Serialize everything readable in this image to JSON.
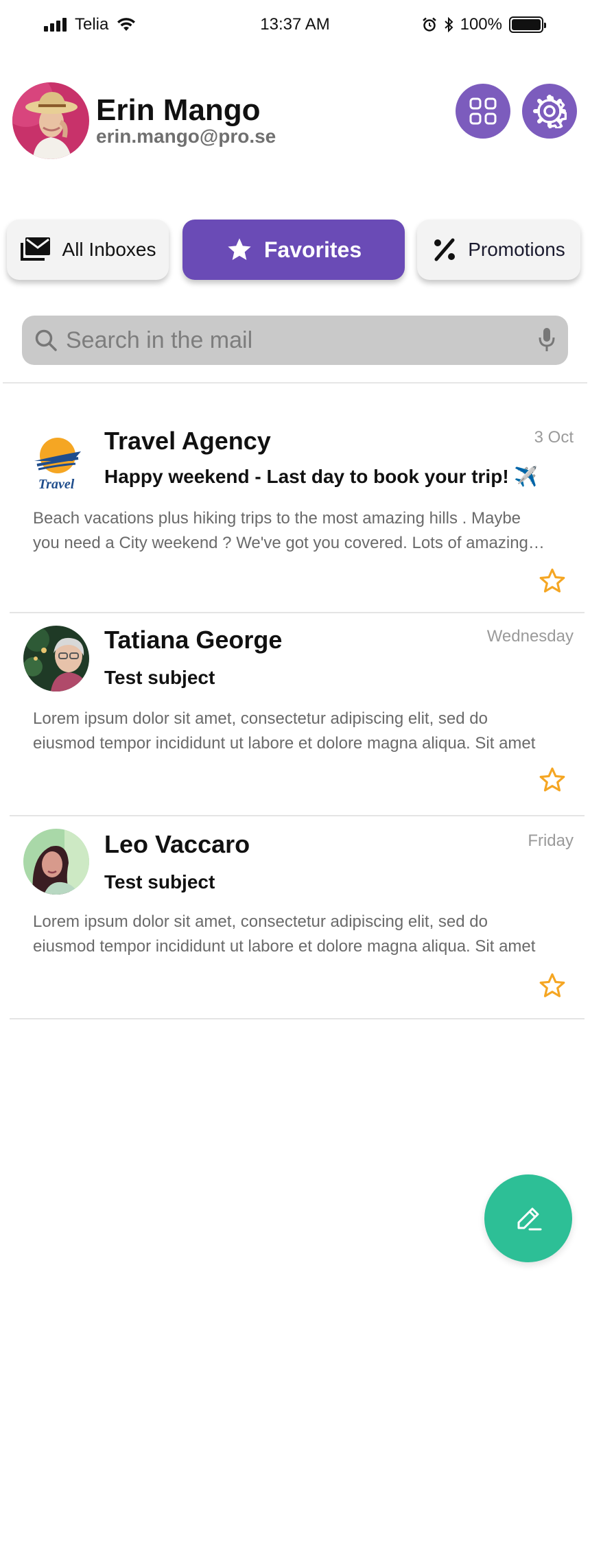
{
  "status_bar": {
    "carrier": "Telia",
    "time": "13:37 AM",
    "battery": "100%",
    "battery_level": 1.0,
    "icons": [
      "signal-icon",
      "wifi-icon",
      "alarm-icon",
      "bluetooth-icon",
      "battery-icon"
    ]
  },
  "profile": {
    "name": "Erin Mango",
    "email": "erin.mango@pro.se",
    "actions": [
      "apps-grid-icon",
      "gear-icon"
    ]
  },
  "tabs": [
    {
      "label": "All Inboxes",
      "icon": "mail-icon",
      "active": false
    },
    {
      "label": "Favorites",
      "icon": "star-icon",
      "active": true
    },
    {
      "label": "Promotions",
      "icon": "percent-icon",
      "active": false
    }
  ],
  "search": {
    "placeholder": "Search in the mail",
    "value": "",
    "icons": [
      "search-icon",
      "microphone-icon"
    ]
  },
  "mails": [
    {
      "sender": "Travel Agency",
      "date": "3 Oct",
      "subject": "Happy weekend - Last day to book your trip! ✈️",
      "preview_line1": "Beach vacations plus hiking trips to the most amazing hills . Maybe",
      "preview_line2": "you need a City weekend ? We've got you covered. Lots of amazing…",
      "logo_text": "Travel",
      "starred": true
    },
    {
      "sender": "Tatiana George",
      "date": "Wednesday",
      "subject": "Test subject",
      "preview_line1": "Lorem ipsum dolor sit amet, consectetur adipiscing elit, sed do",
      "preview_line2": "eiusmod tempor incididunt ut labore et dolore magna aliqua. Sit amet",
      "starred": true
    },
    {
      "sender": "Leo Vaccaro",
      "date": "Friday",
      "subject": "Test subject",
      "preview_line1": "Lorem ipsum dolor sit amet, consectetur adipiscing elit, sed do",
      "preview_line2": "eiusmod tempor incididunt ut labore et dolore magna aliqua. Sit amet",
      "starred": true
    }
  ],
  "fab": {
    "icon": "compose-pencil-icon"
  },
  "colors": {
    "accent": "#6a4bb6",
    "accent_light": "#7c5cbd",
    "fab": "#2dbf96",
    "star": "#f5a623",
    "search_bg": "#c9c9c9"
  }
}
